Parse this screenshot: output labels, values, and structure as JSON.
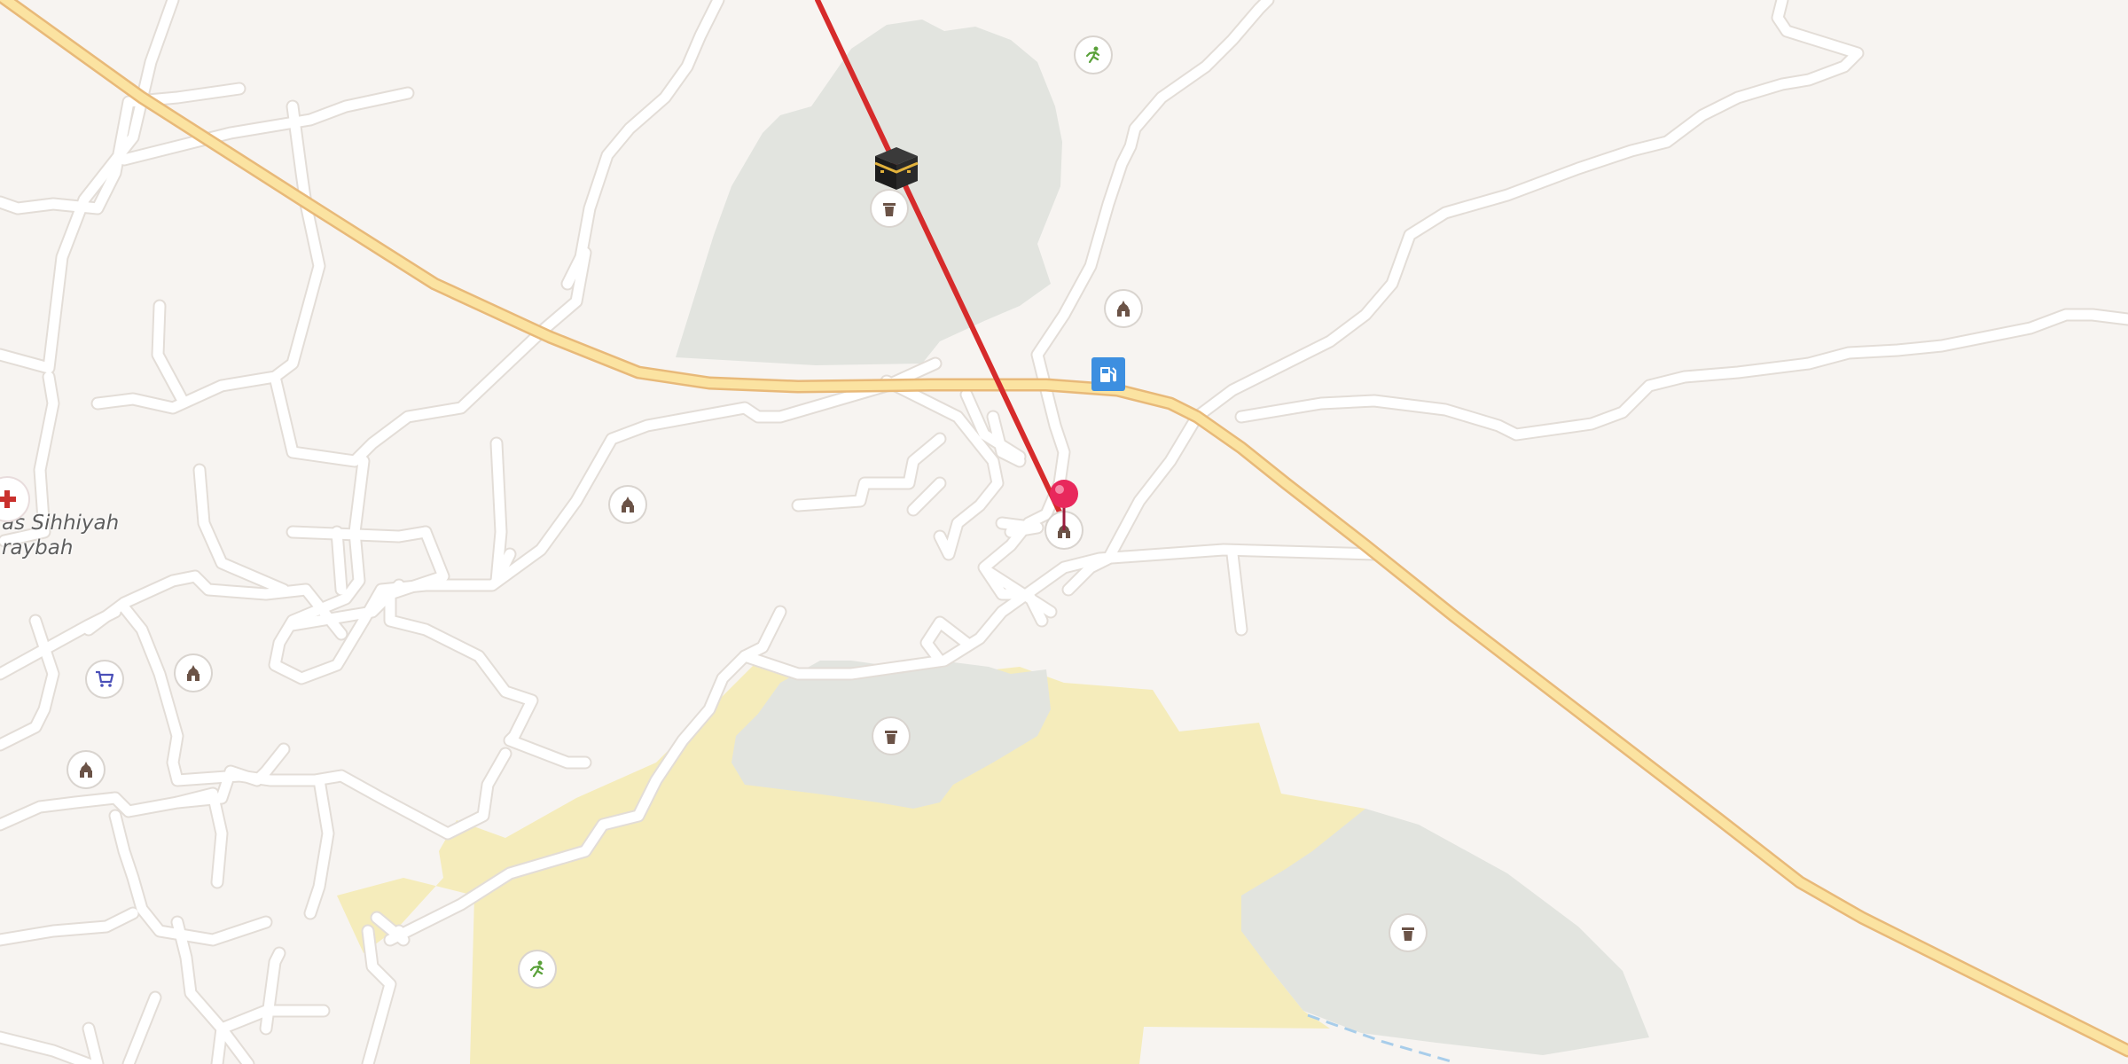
{
  "map": {
    "colors": {
      "land": "#f7f4f1",
      "road": "#ffffff",
      "road_casing": "#e3ddd7",
      "highway": "#fbe3a1",
      "highway_casing": "#e8b979",
      "park": "#e2e4df",
      "sand": "#f5ecbb",
      "route": "#d62b2b",
      "pin": "#e8285c",
      "fuel": "#3d8fe0",
      "waterway": "#a8cdea"
    },
    "labels": {
      "place_line1": "as Sihhiyah",
      "place_line2": "raybah"
    },
    "pois": [
      {
        "icon": "mosque-icon",
        "category": "mosque"
      },
      {
        "icon": "mosque-icon",
        "category": "mosque"
      },
      {
        "icon": "mosque-icon",
        "category": "mosque"
      },
      {
        "icon": "mosque-icon",
        "category": "mosque"
      },
      {
        "icon": "mosque-icon",
        "category": "mosque"
      },
      {
        "icon": "cemetery-icon",
        "category": "cemetery"
      },
      {
        "icon": "cemetery-icon",
        "category": "cemetery"
      },
      {
        "icon": "cemetery-icon",
        "category": "cemetery"
      },
      {
        "icon": "sports-icon",
        "category": "sports"
      },
      {
        "icon": "sports-icon",
        "category": "sports"
      },
      {
        "icon": "shopping-cart-icon",
        "category": "shop"
      },
      {
        "icon": "fuel-station-icon",
        "category": "fuel"
      },
      {
        "icon": "hospital-cross-icon",
        "category": "hospital"
      },
      {
        "icon": "kaaba-icon",
        "category": "qibla"
      },
      {
        "icon": "location-pin-icon",
        "category": "selected-location"
      }
    ]
  }
}
